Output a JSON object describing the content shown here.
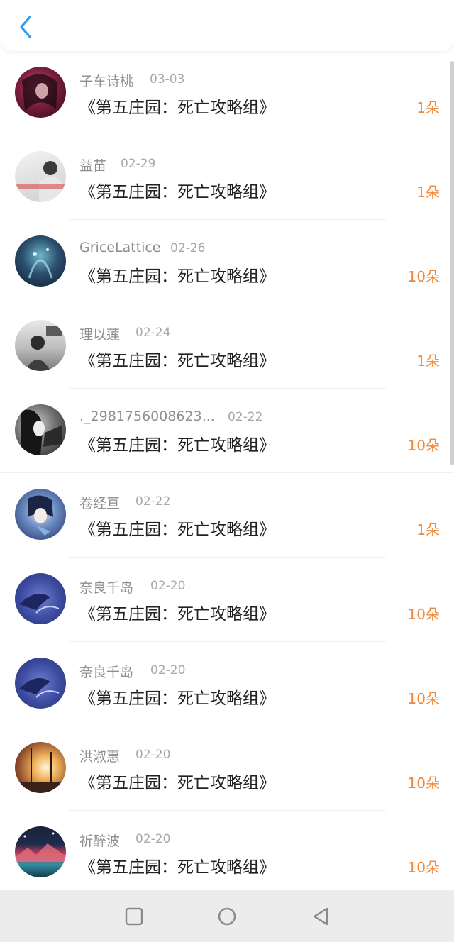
{
  "header": {
    "back_icon": "chevron-left-icon",
    "accent": "#2e9cf0"
  },
  "list": {
    "items": [
      {
        "name": "子车诗桃",
        "date": "03-03",
        "title": "《第五庄园：死亡攻略组》",
        "amount": "1朵"
      },
      {
        "name": "益苗",
        "date": "02-29",
        "title": "《第五庄园：死亡攻略组》",
        "amount": "1朵"
      },
      {
        "name": "GriceLattice",
        "date": "02-26",
        "title": "《第五庄园：死亡攻略组》",
        "amount": "10朵"
      },
      {
        "name": "理以莲",
        "date": "02-24",
        "title": "《第五庄园：死亡攻略组》",
        "amount": "1朵"
      },
      {
        "name": "._2981756008623...",
        "date": "02-22",
        "title": "《第五庄园：死亡攻略组》",
        "amount": "10朵"
      },
      {
        "name": "卷经亘",
        "date": "02-22",
        "title": "《第五庄园：死亡攻略组》",
        "amount": "1朵"
      },
      {
        "name": "奈良千岛",
        "date": "02-20",
        "title": "《第五庄园：死亡攻略组》",
        "amount": "10朵"
      },
      {
        "name": "奈良千岛",
        "date": "02-20",
        "title": "《第五庄园：死亡攻略组》",
        "amount": "10朵"
      },
      {
        "name": "洪淑惠",
        "date": "02-20",
        "title": "《第五庄园：死亡攻略组》",
        "amount": "10朵"
      },
      {
        "name": "祈醉波",
        "date": "02-20",
        "title": "《第五庄园：死亡攻略组》",
        "amount": "10朵"
      }
    ]
  },
  "navbar": {
    "recents_icon": "square-icon",
    "home_icon": "circle-icon",
    "back_icon": "triangle-back-icon"
  },
  "colors": {
    "amount": "#f0883a",
    "name": "#8e8e8e",
    "date": "#a9a9a9",
    "title": "#222222"
  }
}
